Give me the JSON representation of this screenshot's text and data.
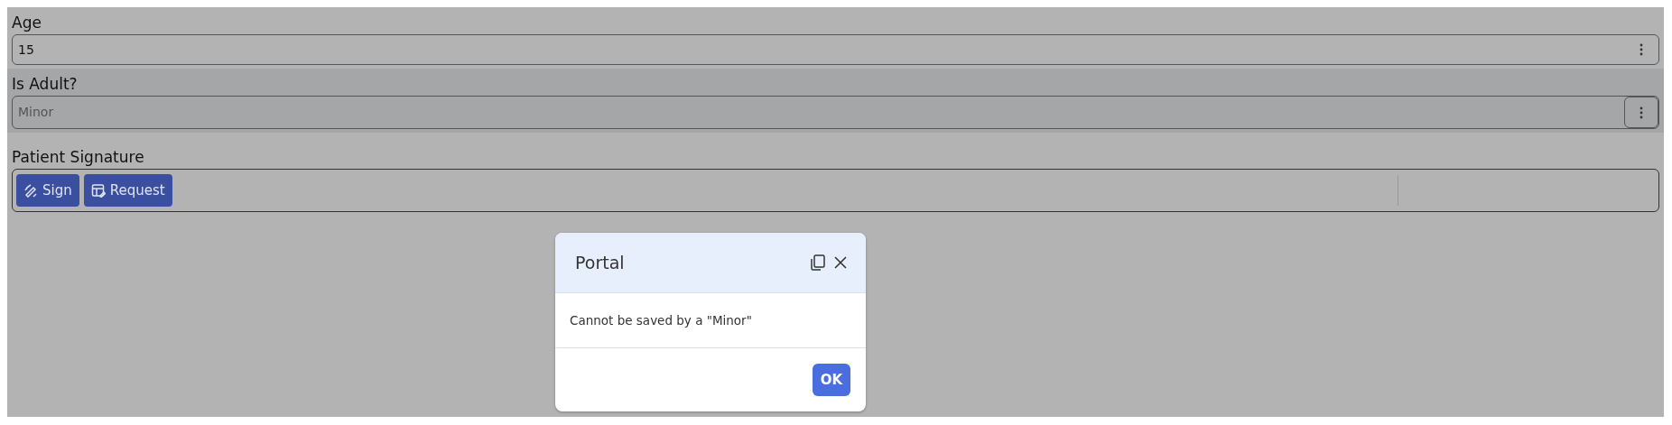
{
  "fields": [
    {
      "kind": "input",
      "label": "Age",
      "value": "15",
      "disabled": false
    },
    {
      "kind": "input",
      "label": "Is Adult?",
      "value": "Minor",
      "disabled": true
    },
    {
      "kind": "signature",
      "label": "Patient Signature",
      "buttons": [
        {
          "kind": "sign",
          "label": "Sign"
        },
        {
          "kind": "request",
          "label": "Request"
        }
      ]
    }
  ],
  "dialog": {
    "title": "Portal",
    "message": "Cannot be saved by a \"Minor\"",
    "buttons": [
      "OK"
    ]
  }
}
